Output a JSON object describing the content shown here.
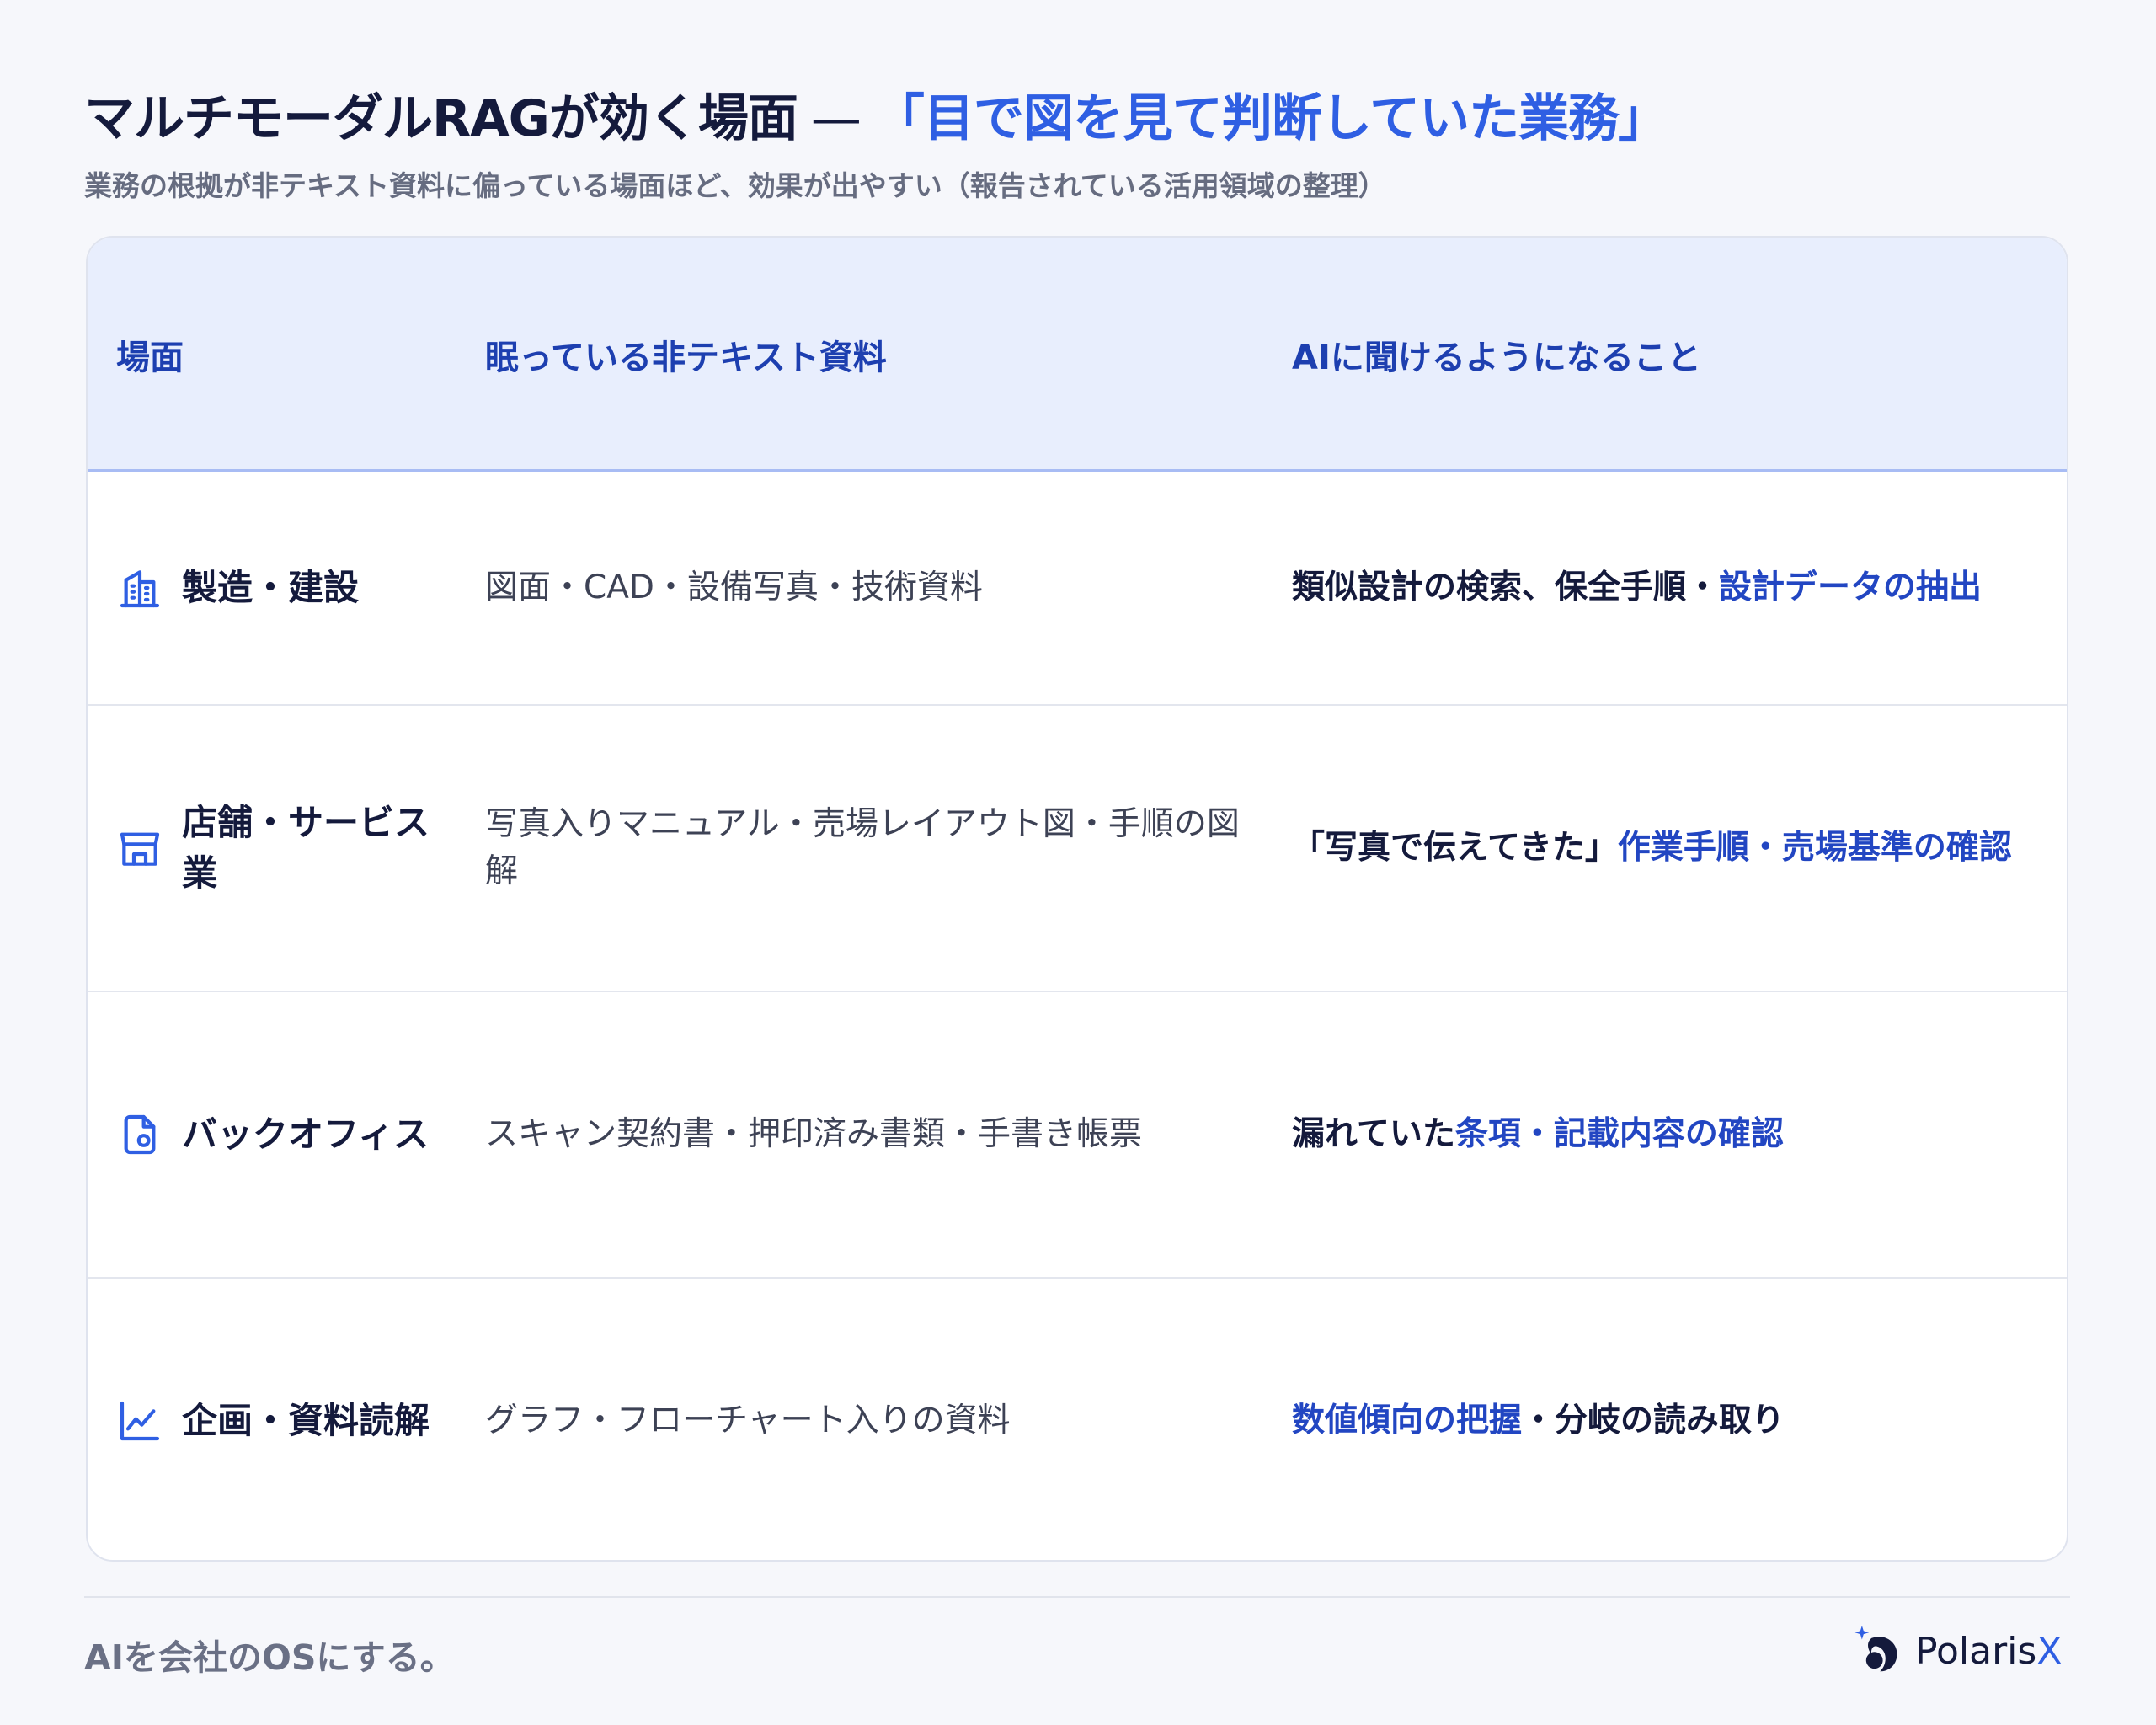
{
  "header": {
    "title_main": "マルチモーダルRAGが効く場面",
    "title_dash": "—",
    "title_accent": "「目で図を見て判断していた業務」",
    "subtitle": "業務の根拠が非テキスト資料に偏っている場面ほど、効果が出やすい（報告されている活用領域の整理）"
  },
  "table": {
    "headers": [
      "場面",
      "眠っている非テキスト資料",
      "AIに聞けるようになること"
    ],
    "rows": [
      {
        "icon": "building-icon",
        "scene": "製造・建設",
        "material": "図面・CAD・設備写真・技術資料",
        "ai_plain": "類似設計の検索、保全手順・",
        "ai_highlight": "設計データの抽出",
        "ai_tail": ""
      },
      {
        "icon": "store-icon",
        "scene": "店舗・サービス業",
        "material": "写真入りマニュアル・売場レイアウト図・手順の図解",
        "ai_plain": "「写真で伝えてきた」",
        "ai_highlight": "作業手順・売場基準の確認",
        "ai_tail": ""
      },
      {
        "icon": "document-icon",
        "scene": "バックオフィス",
        "material": "スキャン契約書・押印済み書類・手書き帳票",
        "ai_plain": "漏れていた",
        "ai_highlight": "条項・記載内容の確認",
        "ai_tail": ""
      },
      {
        "icon": "chart-line-icon",
        "scene": "企画・資料読解",
        "material": "グラフ・フローチャート入りの資料",
        "ai_plain": "",
        "ai_highlight": "数値傾向の把握",
        "ai_tail": "・分岐の読み取り"
      }
    ]
  },
  "footer": {
    "tagline": "AIを会社のOSにする。",
    "logo_text_main": "Polaris",
    "logo_text_accent": "X"
  },
  "colors": {
    "accent": "#2f5fe3",
    "highlight": "#2246c2",
    "header_bg": "#e8eefd",
    "text": "#141a3c"
  }
}
